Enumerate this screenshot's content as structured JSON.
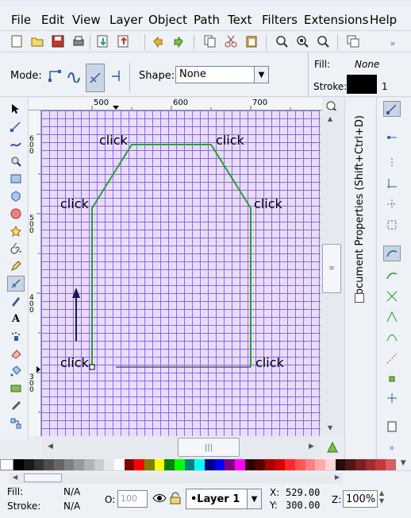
{
  "menu": [
    "File",
    "Edit",
    "View",
    "Layer",
    "Object",
    "Path",
    "Text",
    "Filters",
    "Extensions",
    "Help"
  ],
  "controls": {
    "mode_label": "Mode:",
    "shape_label": "Shape:",
    "shape_value": "None",
    "fill_label": "Fill:",
    "fill_value": "None",
    "stroke_label": "Stroke:",
    "stroke_width": "1"
  },
  "ruler": {
    "h_ticks": [
      "500",
      "600",
      "700"
    ],
    "v_ticks": [
      "600",
      "500",
      "400",
      "300"
    ]
  },
  "canvas": {
    "labels": [
      "click",
      "click",
      "click",
      "click",
      "click",
      "click"
    ]
  },
  "dock": {
    "title": "Document Properties (Shift+Ctrl+D)"
  },
  "status": {
    "fill_label": "Fill:",
    "fill_value": "N/A",
    "stroke_label": "Stroke:",
    "stroke_value": "N/A",
    "opacity_label": "O:",
    "opacity_value": "100",
    "layer_value": "•Layer 1",
    "x_label": "X:",
    "x_value": "529.00",
    "y_label": "Y:",
    "y_value": "300.00",
    "zoom_label": "Z:",
    "zoom_value": "100%"
  },
  "colors": {
    "path": "#2aa12a",
    "grid": "#8a6ae6",
    "canvas_bg": "#e9dcfb"
  }
}
